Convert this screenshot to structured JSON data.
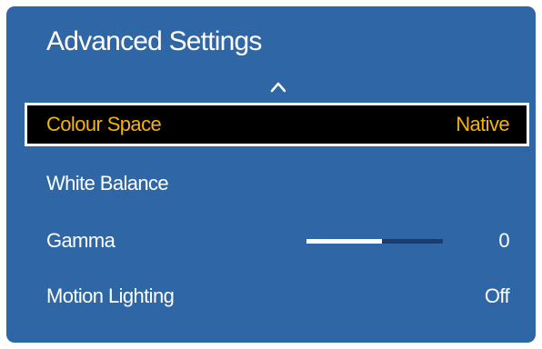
{
  "menu": {
    "title": "Advanced Settings",
    "scroll_up_icon": "chevron-up-icon",
    "items": [
      {
        "label": "Colour Space",
        "value": "Native",
        "focused": true
      },
      {
        "label": "White Balance",
        "value": ""
      },
      {
        "label": "Gamma",
        "value": "0",
        "slider_level": 0.55
      },
      {
        "label": "Motion Lighting",
        "value": "Off"
      }
    ]
  },
  "colors": {
    "panel_background": "#2f67a6",
    "focus_background": "#000000",
    "focus_text": "#f5b400",
    "slider_track": "#1e3b6e",
    "slider_fill": "#ffffff"
  }
}
